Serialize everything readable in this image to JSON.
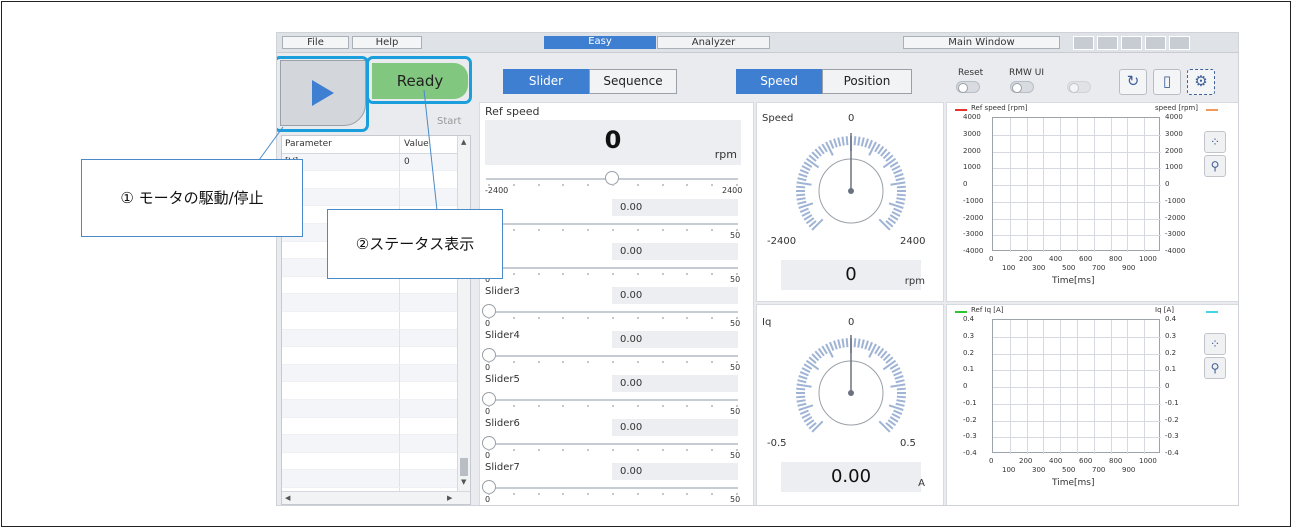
{
  "menu": {
    "file": "File",
    "help": "Help",
    "easy": "Easy",
    "analyzer": "Analyzer",
    "main_window": "Main Window"
  },
  "control": {
    "status": "Ready",
    "start": "Start"
  },
  "table": {
    "header_param": "Parameter",
    "header_value": "Value",
    "rows": [
      {
        "param": "[V]",
        "value": "0"
      }
    ]
  },
  "tabs": {
    "slider": "Slider",
    "sequence": "Sequence",
    "speed": "Speed",
    "position": "Position"
  },
  "toggles": {
    "reset": "Reset",
    "rmw_ui": "RMW UI"
  },
  "ref_speed": {
    "label": "Ref speed",
    "value": "0",
    "unit": "rpm",
    "min": "-2400",
    "max": "2400",
    "knob_fraction": 0.5
  },
  "sliders": [
    {
      "name": "",
      "value": "0.00",
      "min": "",
      "max": "50"
    },
    {
      "name": "",
      "value": "0.00",
      "min": "0",
      "max": "50"
    },
    {
      "name": "Slider3",
      "value": "0.00",
      "min": "0",
      "max": "50"
    },
    {
      "name": "Slider4",
      "value": "0.00",
      "min": "0",
      "max": "50"
    },
    {
      "name": "Slider5",
      "value": "0.00",
      "min": "0",
      "max": "50"
    },
    {
      "name": "Slider6",
      "value": "0.00",
      "min": "0",
      "max": "50"
    },
    {
      "name": "Slider7",
      "value": "0.00",
      "min": "0",
      "max": "50"
    }
  ],
  "gauges": [
    {
      "label": "Speed",
      "top": "0",
      "min": "-2400",
      "max": "2400",
      "value": "0",
      "unit": "rpm"
    },
    {
      "label": "Iq",
      "top": "0",
      "min": "-0.5",
      "max": "0.5",
      "value": "0.00",
      "unit": "A"
    }
  ],
  "charts": [
    {
      "legend_left": "Ref speed [rpm]",
      "legend_right": "speed [rpm]",
      "left_color": "#e8322e",
      "right_color": "#f39a5a",
      "y_ticks": [
        "4000",
        "3000",
        "2000",
        "1000",
        "0",
        "-1000",
        "-2000",
        "-3000",
        "-4000"
      ],
      "x_top": [
        "0",
        "200",
        "400",
        "600",
        "800",
        "1000"
      ],
      "x_bot": [
        "100",
        "300",
        "500",
        "700",
        "900"
      ],
      "xlabel": "Time[ms]"
    },
    {
      "legend_left": "Ref Iq [A]",
      "legend_right": "Iq [A]",
      "left_color": "#2fc32f",
      "right_color": "#3fd7e8",
      "y_ticks": [
        "0.4",
        "0.3",
        "0.2",
        "0.1",
        "0",
        "-0.1",
        "-0.2",
        "-0.3",
        "-0.4"
      ],
      "x_top": [
        "0",
        "200",
        "400",
        "600",
        "800",
        "1000"
      ],
      "x_bot": [
        "100",
        "300",
        "500",
        "700",
        "900"
      ],
      "xlabel": "Time[ms]"
    }
  ],
  "chart_data": [
    {
      "type": "line",
      "title": "",
      "xlabel": "Time[ms]",
      "ylabel": "",
      "xlim": [
        0,
        1000
      ],
      "ylim": [
        -4000,
        4000
      ],
      "grid": true,
      "legend": "top",
      "series": [
        {
          "name": "Ref speed [rpm]",
          "values": []
        },
        {
          "name": "speed [rpm]",
          "values": []
        }
      ]
    },
    {
      "type": "line",
      "title": "",
      "xlabel": "Time[ms]",
      "ylabel": "",
      "xlim": [
        0,
        1000
      ],
      "ylim": [
        -0.4,
        0.4
      ],
      "grid": true,
      "legend": "top",
      "series": [
        {
          "name": "Ref Iq [A]",
          "values": []
        },
        {
          "name": "Iq [A]",
          "values": []
        }
      ]
    }
  ],
  "callouts": {
    "motor": "① モータの駆動/停止",
    "status": "②ステータス表示"
  },
  "colors": {
    "accent": "#3f7fd1",
    "ready": "#82c77f",
    "highlight": "#1b9fdc"
  }
}
